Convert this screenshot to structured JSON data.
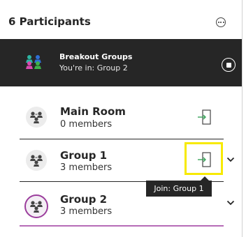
{
  "header": {
    "title": "6 Participants",
    "more_icon": "ellipsis-circle-icon"
  },
  "breakout": {
    "title": "Breakout Groups",
    "status": "You're in: Group 2",
    "icon": "people-colored-icon",
    "stop_icon": "stop-circle-icon"
  },
  "rooms": [
    {
      "name": "Main Room",
      "count": "0 members",
      "expandable": false,
      "selected": false
    },
    {
      "name": "Group 1",
      "count": "3 members",
      "expandable": true,
      "selected": false
    },
    {
      "name": "Group 2",
      "count": "3 members",
      "expandable": true,
      "selected": true
    }
  ],
  "tooltip": {
    "text": "Join: Group 1"
  },
  "colors": {
    "banner_bg": "#262626",
    "join_green": "#3aa45a",
    "focus_highlight": "#f7ea00",
    "selected_purple": "#9b3d9c",
    "person_teal": "#2db6a3",
    "person_blue": "#2f6fd6",
    "person_pink": "#d94ab0",
    "person_green": "#3fb24b"
  }
}
